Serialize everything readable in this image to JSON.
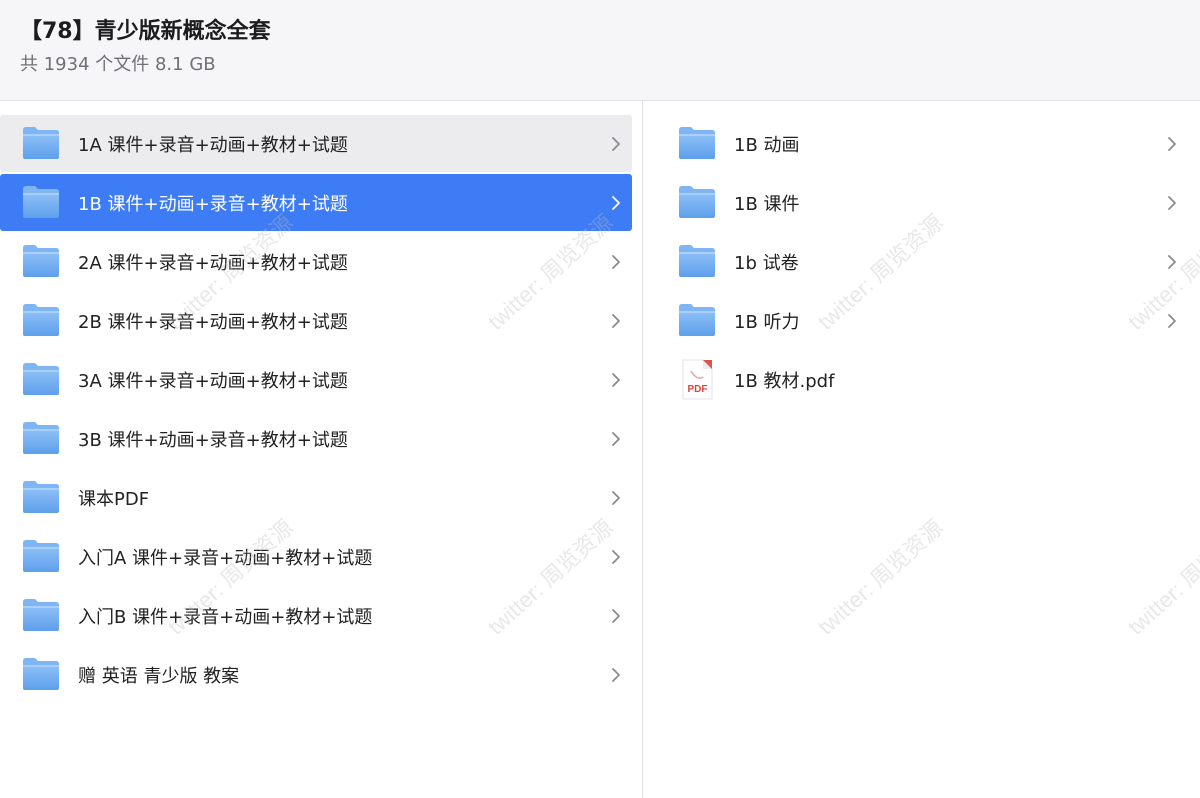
{
  "header": {
    "title": "【78】青少版新概念全套",
    "summary": "共 1934 个文件 8.1 GB"
  },
  "left_pane": {
    "items": [
      {
        "label": "1A 课件+录音+动画+教材+试题",
        "icon": "folder-icon",
        "state": "hover"
      },
      {
        "label": "1B 课件+动画+录音+教材+试题",
        "icon": "folder-icon",
        "state": "selected"
      },
      {
        "label": "2A 课件+录音+动画+教材+试题",
        "icon": "folder-icon",
        "state": "normal"
      },
      {
        "label": "2B 课件+录音+动画+教材+试题",
        "icon": "folder-icon",
        "state": "normal"
      },
      {
        "label": "3A 课件+录音+动画+教材+试题",
        "icon": "folder-icon",
        "state": "normal"
      },
      {
        "label": "3B 课件+动画+录音+教材+试题",
        "icon": "folder-icon",
        "state": "normal"
      },
      {
        "label": "课本PDF",
        "icon": "folder-icon",
        "state": "normal"
      },
      {
        "label": "入门A 课件+录音+动画+教材+试题",
        "icon": "folder-icon",
        "state": "normal"
      },
      {
        "label": "入门B 课件+录音+动画+教材+试题",
        "icon": "folder-icon",
        "state": "normal"
      },
      {
        "label": "赠 英语 青少版 教案",
        "icon": "folder-icon",
        "state": "normal"
      }
    ]
  },
  "right_pane": {
    "items": [
      {
        "label": "1B 动画",
        "icon": "folder-icon",
        "has_chevron": true
      },
      {
        "label": "1B 课件",
        "icon": "folder-icon",
        "has_chevron": true
      },
      {
        "label": "1b 试卷",
        "icon": "folder-icon",
        "has_chevron": true
      },
      {
        "label": "1B 听力",
        "icon": "folder-icon",
        "has_chevron": true
      },
      {
        "label": "1B 教材.pdf",
        "icon": "pdf-file-icon",
        "pdf_badge": "PDF",
        "has_chevron": false
      }
    ]
  },
  "watermark": {
    "text": "twitter: 周览资源"
  },
  "colors": {
    "selected_bg": "#3d7cf5",
    "hover_bg": "#ececee",
    "folder_top": "#9cc6f7",
    "folder_body": "#6aa8ef",
    "header_bg": "#f6f6f8"
  }
}
